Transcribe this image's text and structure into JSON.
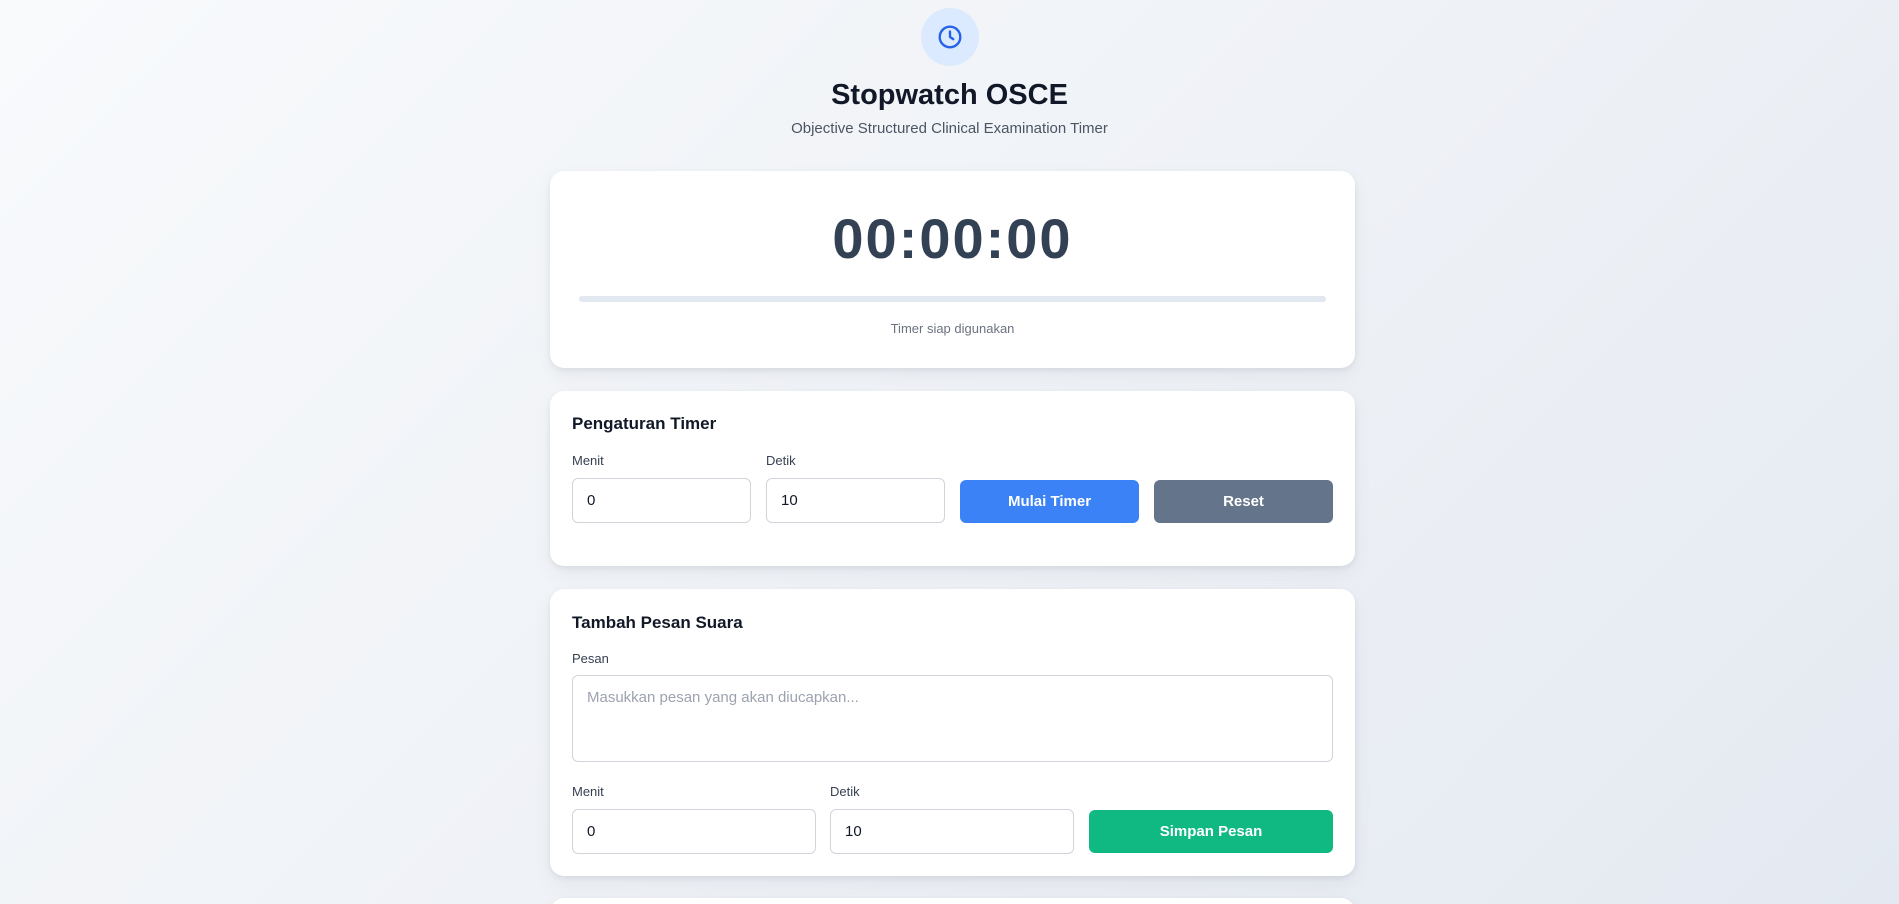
{
  "header": {
    "icon": "clock-icon",
    "title": "Stopwatch OSCE",
    "subtitle": "Objective Structured Clinical Examination Timer"
  },
  "timer": {
    "display": "00:00:00",
    "progress_percent": 0,
    "status": "Timer siap digunakan"
  },
  "settings": {
    "title": "Pengaturan Timer",
    "minutes_label": "Menit",
    "minutes_value": "0",
    "seconds_label": "Detik",
    "seconds_value": "10",
    "start_label": "Mulai Timer",
    "reset_label": "Reset"
  },
  "voice": {
    "title": "Tambah Pesan Suara",
    "message_label": "Pesan",
    "message_placeholder": "Masukkan pesan yang akan diucapkan...",
    "minutes_label": "Menit",
    "minutes_value": "0",
    "seconds_label": "Detik",
    "seconds_value": "10",
    "save_label": "Simpan Pesan"
  },
  "colors": {
    "primary": "#3b82f6",
    "reset": "#64748b",
    "save": "#10b981",
    "icon_bg": "#dbeafe"
  }
}
